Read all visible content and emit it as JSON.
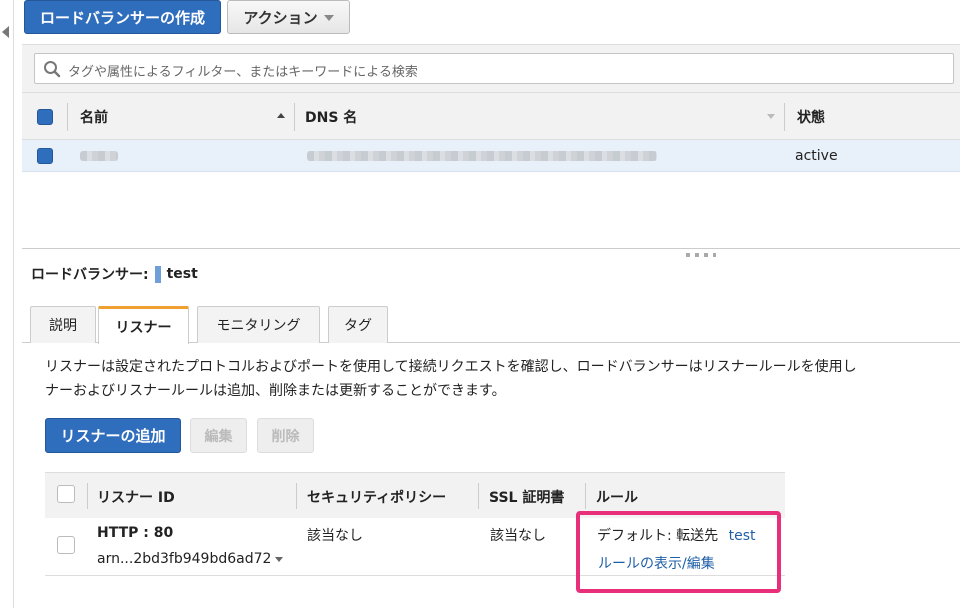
{
  "toolbar": {
    "create_label": "ロードバランサーの作成",
    "action_label": "アクション"
  },
  "search": {
    "placeholder": "タグや属性によるフィルター、またはキーワードによる検索"
  },
  "lb_table": {
    "headers": {
      "name": "名前",
      "dns": "DNS 名",
      "state": "状態"
    },
    "row": {
      "state": "active"
    }
  },
  "detail": {
    "title_prefix": "ロードバランサー:",
    "lb_name": "test",
    "tabs": [
      "説明",
      "リスナー",
      "モニタリング",
      "タグ"
    ],
    "active_tab": "リスナー",
    "description_line1": "リスナーは設定されたプロトコルおよびポートを使用して接続リクエストを確認し、ロードバランサーはリスナールールを使用し",
    "description_line2": "ナーおよびリスナールールは追加、削除または更新することができます。",
    "buttons": {
      "add": "リスナーの追加",
      "edit": "編集",
      "delete": "削除"
    }
  },
  "listener_table": {
    "headers": {
      "id": "リスナー ID",
      "policy": "セキュリティポリシー",
      "ssl": "SSL 証明書",
      "rules": "ルール"
    },
    "row": {
      "protocol": "HTTP : 80",
      "arn": "arn...2bd3fb949bd6ad72",
      "policy": "該当なし",
      "ssl": "該当なし",
      "default_prefix": "デフォルト:  転送先",
      "default_target": "test",
      "rules_link": "ルールの表示/編集"
    }
  },
  "colors": {
    "primary": "#2f6dbd",
    "highlight": "#e8307a",
    "active_tab_accent": "#f0a030",
    "link": "#1f5fa8"
  }
}
